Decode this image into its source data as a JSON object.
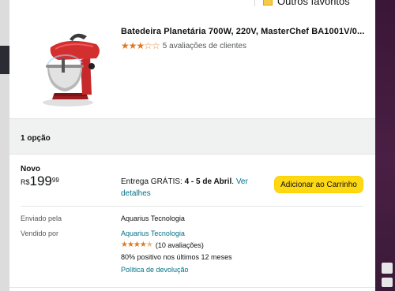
{
  "top": {
    "label": "Outros favoritos"
  },
  "product": {
    "title": "Batedeira Planetária 700W, 220V, MasterChef BA1001V/0...",
    "rating_text": "5 avaliações de clientes",
    "rating_value": 3,
    "rating_max": 5,
    "image_icon": "stand-mixer-image"
  },
  "options": {
    "count_label": "1 opção"
  },
  "offer": {
    "condition": "Novo",
    "price_currency": "R$",
    "price_whole": "199",
    "price_fraction": "99",
    "delivery_prefix": "Entrega GRÁTIS: ",
    "delivery_dates": "4 - 5 de Abril",
    "delivery_sep": ". ",
    "delivery_link": "Ver detalhes",
    "add_to_cart": "Adicionar ao Carrinho"
  },
  "seller": {
    "ships_from_label": "Enviado pela",
    "ships_from_value": "Aquarius Tecnologia",
    "sold_by_label": "Vendido por",
    "sold_by_value": "Aquarius Tecnologia",
    "seller_rating_value": 4.5,
    "seller_rating_count": "(10 avaliações)",
    "positive_text": "80% positivo nos últimos 12 meses",
    "return_policy": "Política de devolução"
  },
  "colors": {
    "accent_yellow": "#FFD814",
    "link_teal": "#007185",
    "star_orange": "#DE7921",
    "side_purple": "#3D1A38"
  }
}
